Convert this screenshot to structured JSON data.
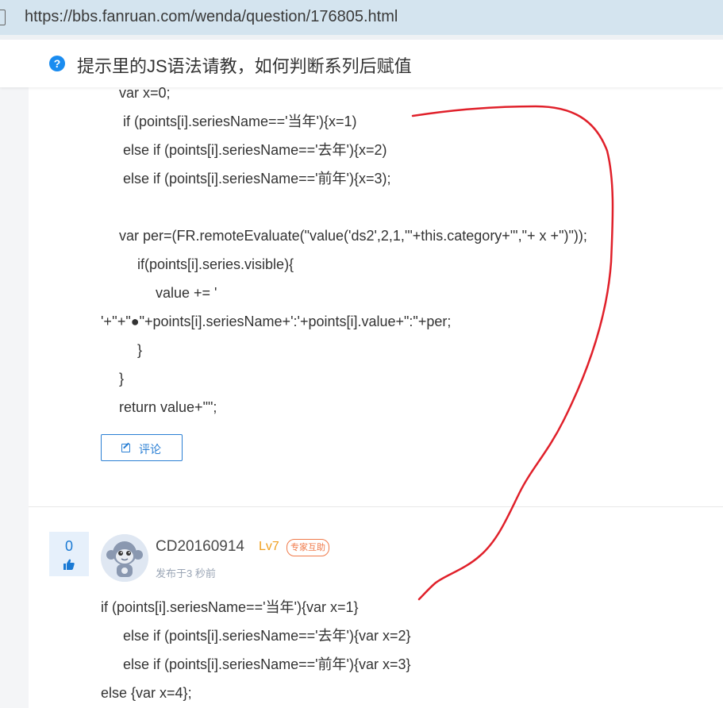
{
  "browser": {
    "url": "https://bbs.fanruan.com/wenda/question/176805.html"
  },
  "header": {
    "question_icon": "question-icon",
    "title": "提示里的JS语法请教，如何判断系列后赋值"
  },
  "answer_code": [
    "var x=0;",
    " if (points[i].seriesName=='当年'){x=1)",
    " else if (points[i].seriesName=='去年'){x=2)",
    " else if (points[i].seriesName=='前年'){x=3);",
    "var per=(FR.remoteEvaluate(\"value('ds2',2,1,'\"+this.category+\"',\"+ x +\")\"));",
    "if(points[i].series.visible){",
    "value += '",
    "'+''+\"●\"+points[i].seriesName+':'+points[i].value+\":\"+per;",
    "}",
    "}",
    "return value+\"\";"
  ],
  "comment_button": {
    "icon": "edit-icon",
    "label": "评论"
  },
  "reply": {
    "votes": "0",
    "username": "CD20160914",
    "level": "Lv7",
    "badge": "专家互助",
    "time": "发布于3 秒前",
    "code": [
      "if (points[i].seriesName=='当年'){var x=1}",
      " else if (points[i].seriesName=='去年'){var x=2}",
      " else if (points[i].seriesName=='前年'){var x=3}",
      "else {var x=4};"
    ]
  },
  "colors": {
    "accent": "#2a7fd4",
    "annotation": "#e0202a",
    "level": "#f0a020",
    "badge": "#f07a4a"
  }
}
